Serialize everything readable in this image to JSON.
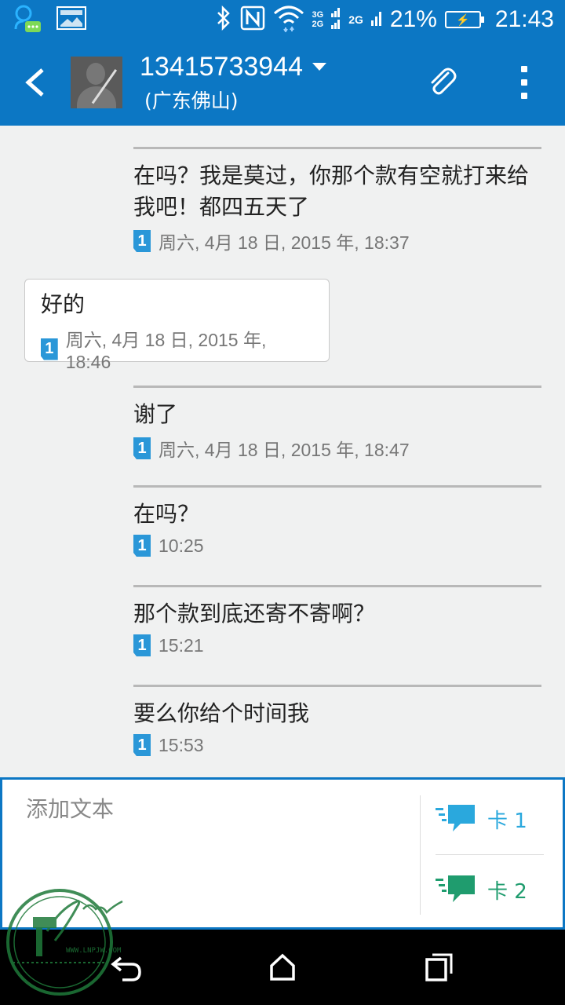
{
  "status_bar": {
    "network_3g": "3G",
    "network_2g_a": "2G",
    "network_2g_b": "2G",
    "battery_percent": "21%",
    "time": "21:43"
  },
  "header": {
    "phone_number": "13415733944",
    "location": "(广东佛山)"
  },
  "messages": [
    {
      "direction": "out",
      "text": "在吗？我是莫过，你那个款有空就打来给我吧！都四五天了",
      "sim": "1",
      "time": "周六, 4月 18 日, 2015 年, 18:37"
    },
    {
      "direction": "in",
      "text": "好的",
      "sim": "1",
      "time": "周六, 4月 18 日, 2015 年, 18:46"
    },
    {
      "direction": "out",
      "text": "谢了",
      "sim": "1",
      "time": "周六, 4月 18 日, 2015 年, 18:47"
    },
    {
      "direction": "out",
      "text": "在吗？",
      "sim": "1",
      "time": "10:25"
    },
    {
      "direction": "out",
      "text": "那个款到底还寄不寄啊？",
      "sim": "1",
      "time": "15:21"
    },
    {
      "direction": "out",
      "text": "要么你给个时间我",
      "sim": "1",
      "time": "15:53"
    }
  ],
  "compose": {
    "placeholder": "添加文本",
    "send_sim1_label": "卡 1",
    "send_sim2_label": "卡 2"
  },
  "watermark": {
    "url": "WWW.LNPJW.COM"
  },
  "colors": {
    "primary": "#0c77c4",
    "sim1": "#2aa8dd",
    "sim2": "#1f9c6e"
  }
}
